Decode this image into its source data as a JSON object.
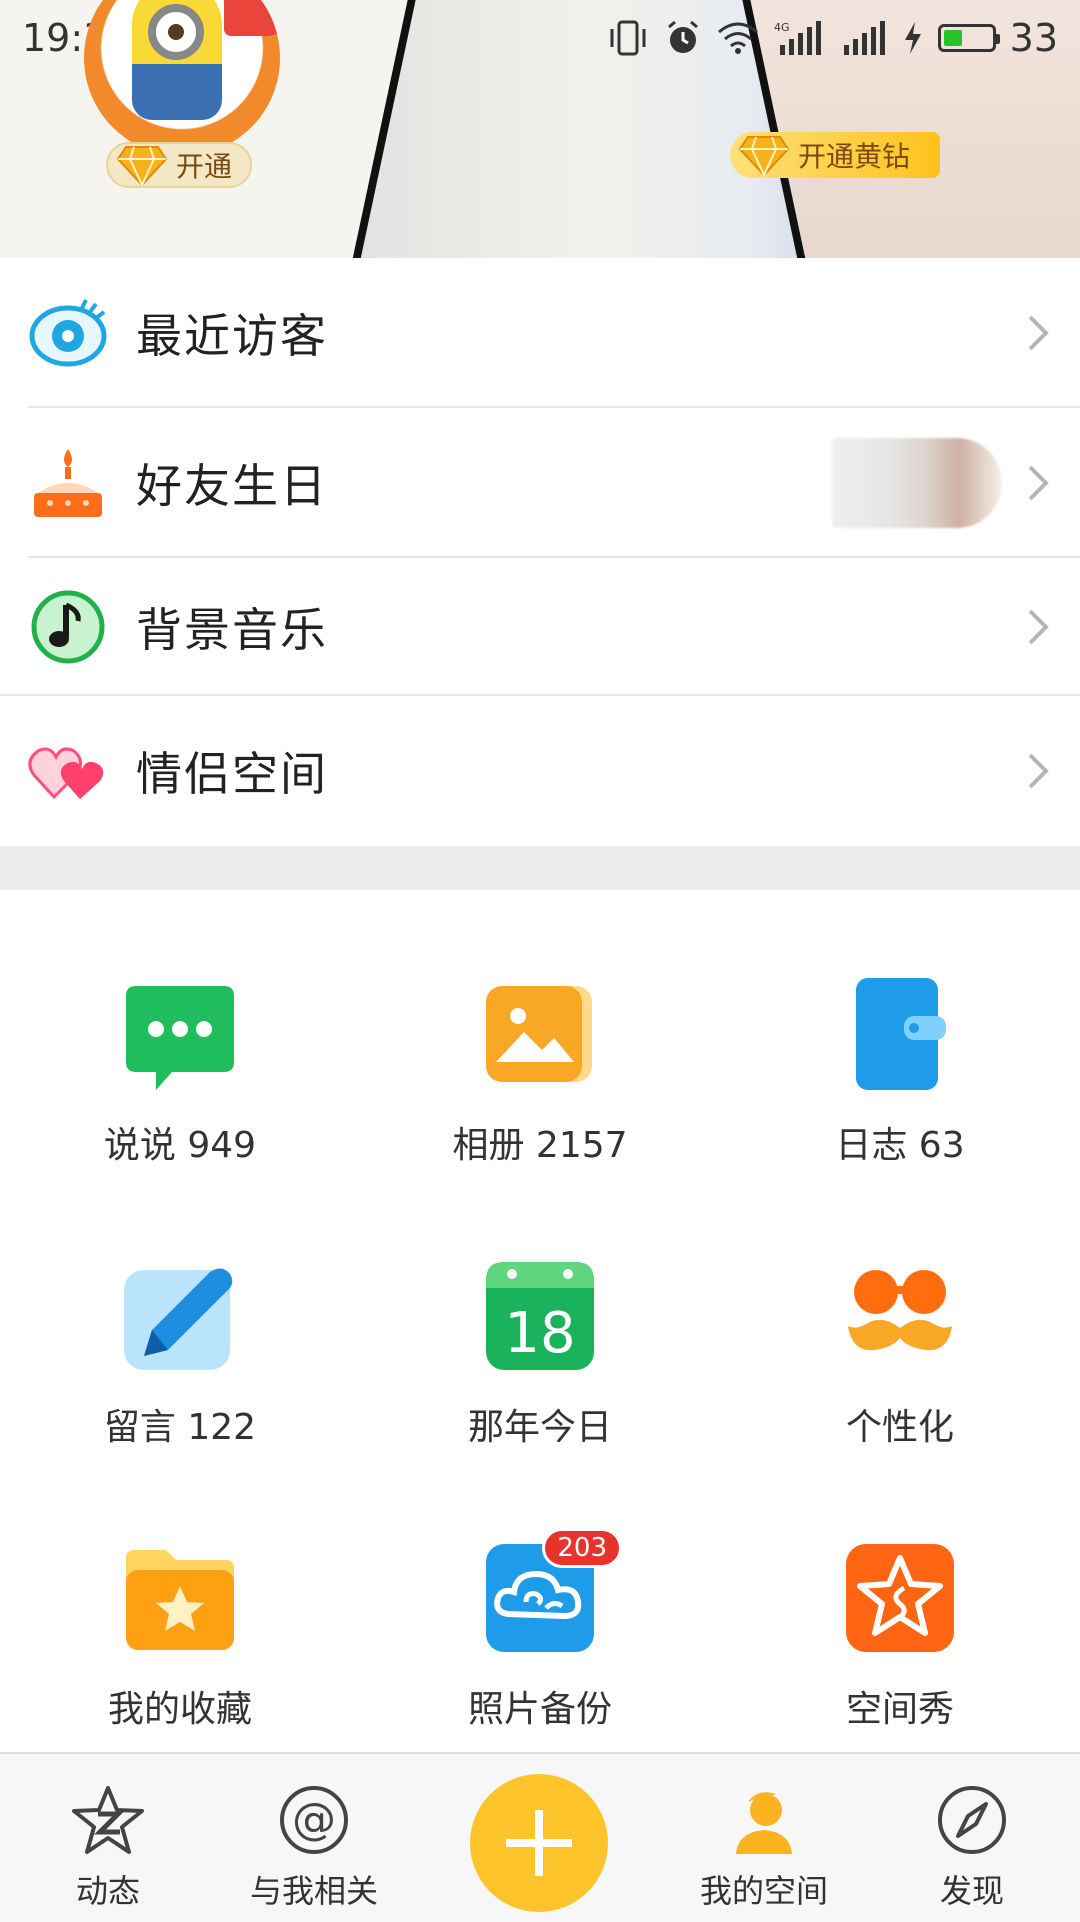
{
  "status_bar": {
    "time": "19:39",
    "battery_level": "33"
  },
  "header": {
    "avatar_vip_label": "开通",
    "vip_banner_label": "开通黄钻"
  },
  "menu": [
    {
      "name": "recent-visitors",
      "label": "最近访客",
      "icon": "eye-icon"
    },
    {
      "name": "friend-birthdays",
      "label": "好友生日",
      "icon": "cake-icon"
    },
    {
      "name": "background-music",
      "label": "背景音乐",
      "icon": "music-note-icon"
    },
    {
      "name": "couple-space",
      "label": "情侣空间",
      "icon": "hearts-icon"
    }
  ],
  "grid": [
    {
      "name": "shuoshuo",
      "label": "说说 949",
      "icon": "chat-bubble-icon"
    },
    {
      "name": "album",
      "label": "相册 2157",
      "icon": "photo-album-icon"
    },
    {
      "name": "diary",
      "label": "日志 63",
      "icon": "wallet-diary-icon"
    },
    {
      "name": "messages",
      "label": "留言 122",
      "icon": "pen-icon"
    },
    {
      "name": "on-this-day",
      "label": "那年今日",
      "icon": "calendar-icon",
      "calendar_day": "18"
    },
    {
      "name": "personalize",
      "label": "个性化",
      "icon": "glasses-mustache-icon"
    },
    {
      "name": "favorites",
      "label": "我的收藏",
      "icon": "star-folder-icon"
    },
    {
      "name": "photo-backup",
      "label": "照片备份",
      "icon": "cloud-icon",
      "badge": "203"
    },
    {
      "name": "space-show",
      "label": "空间秀",
      "icon": "star-badge-icon"
    }
  ],
  "tabbar": [
    {
      "name": "feed",
      "label": "动态",
      "icon": "qzone-star-icon"
    },
    {
      "name": "mentions",
      "label": "与我相关",
      "icon": "at-icon"
    },
    {
      "name": "post",
      "label": "",
      "icon": "plus-icon"
    },
    {
      "name": "my-space",
      "label": "我的空间",
      "icon": "person-icon",
      "active": true
    },
    {
      "name": "discover",
      "label": "发现",
      "icon": "compass-icon"
    }
  ],
  "colors": {
    "accent": "#fcc42a",
    "badge": "#e8322c",
    "divider": "#e6e6e6"
  }
}
